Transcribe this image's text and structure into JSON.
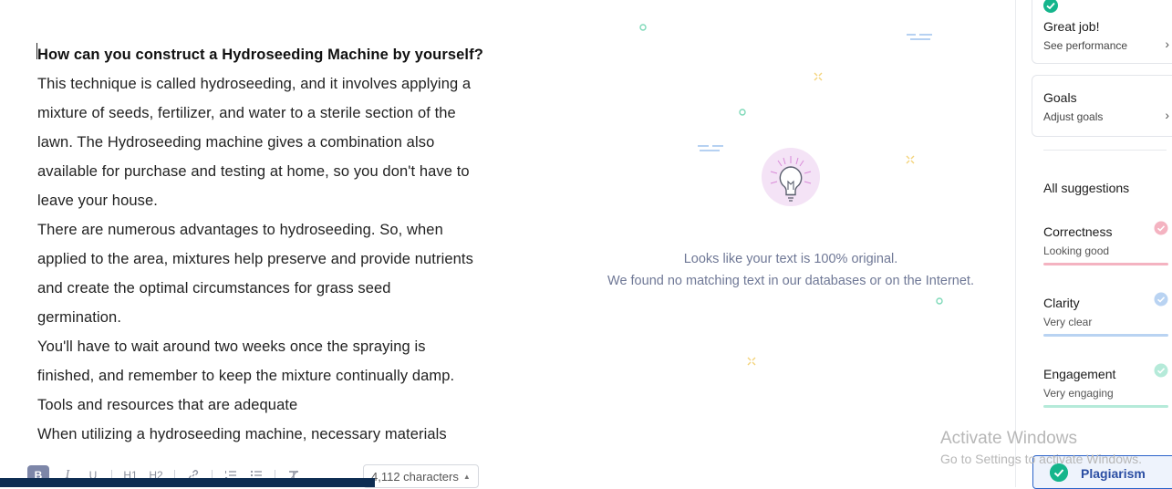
{
  "editor": {
    "lines": [
      "How can you construct a Hydroseeding Machine by yourself?",
      "This technique is called hydroseeding, and it involves applying a",
      "mixture of seeds, fertilizer, and water to a sterile section of the",
      "lawn. The Hydroseeding machine gives a combination also",
      "available for purchase and testing at home, so you don't have to",
      "leave your house.",
      "There are numerous advantages to hydroseeding. So, when",
      "applied to the area, mixtures help preserve and provide nutrients",
      "and create the optimal circumstances for grass seed",
      "germination.",
      "You'll have to wait around two weeks once the spraying is",
      "finished, and remember to keep the mixture continually damp.",
      "Tools and resources that are adequate",
      "When utilizing a hydroseeding machine, necessary materials"
    ],
    "toolbar": {
      "bold": "B",
      "italic": "I",
      "underline": "U",
      "h1": "H1",
      "h2": "H2",
      "char_count": "4,112 characters"
    }
  },
  "result": {
    "line1": "Looks like your text is 100% original.",
    "line2": "We found no matching text in our databases or on the Internet."
  },
  "sidebar": {
    "cards": [
      {
        "title": "Great job!",
        "sub": "See performance"
      },
      {
        "title": "Goals",
        "sub": "Adjust goals"
      }
    ],
    "section_title": "All suggestions",
    "suggestions": [
      {
        "title": "Correctness",
        "sub": "Looking good",
        "color": "#f4b3c1"
      },
      {
        "title": "Clarity",
        "sub": "Very clear",
        "color": "#b9d3f2"
      },
      {
        "title": "Engagement",
        "sub": "Very engaging",
        "color": "#b5ead9"
      }
    ],
    "plagiarism_label": "Plagiarism"
  },
  "watermark": {
    "line1": "Activate Windows",
    "line2": "Go to Settings to activate Windows."
  },
  "colors": {
    "accent_green": "#15b58c",
    "accent_blue": "#2b4ea3",
    "bottom_bar": "#0e2d52"
  }
}
